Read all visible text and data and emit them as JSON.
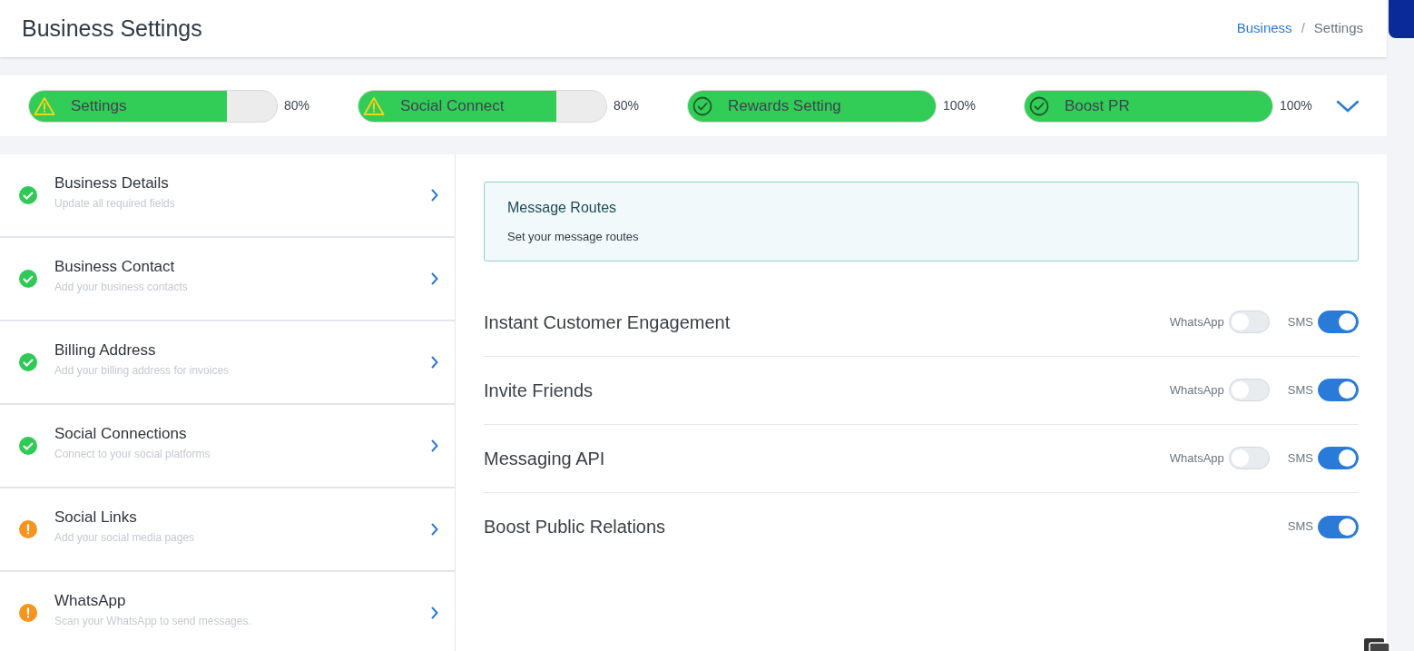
{
  "header": {
    "title": "Business Settings",
    "breadcrumb": [
      {
        "label": "Business",
        "current": false
      },
      {
        "label": "Settings",
        "current": true
      }
    ],
    "separator": "/"
  },
  "progress": [
    {
      "label": "Settings",
      "kind": "warning",
      "level": 0.8,
      "reading": "80%"
    },
    {
      "label": "Social Connect",
      "kind": "warning",
      "level": 0.8,
      "reading": "80%"
    },
    {
      "label": "Rewards Setting",
      "kind": "complete",
      "level": 1,
      "reading": "100%"
    },
    {
      "label": "Boost PR",
      "kind": "complete",
      "level": 1,
      "reading": "100%"
    }
  ],
  "sidebar": {
    "items": [
      {
        "title": "Business Details",
        "subtitle": "Update all required fields",
        "kind": "complete"
      },
      {
        "title": "Business Contact",
        "subtitle": "Add your business contacts",
        "kind": "complete"
      },
      {
        "title": "Billing Address",
        "subtitle": "Add your billing address for invoices",
        "kind": "complete"
      },
      {
        "title": "Social Connections",
        "subtitle": "Connect to your social platforms",
        "kind": "complete"
      },
      {
        "title": "Social Links",
        "subtitle": "Add your social media pages",
        "kind": "warning"
      },
      {
        "title": "WhatsApp",
        "subtitle": "Scan your WhatsApp to send messages.",
        "kind": "warning"
      }
    ]
  },
  "info": {
    "title": "Message Routes",
    "text": "Set your message routes"
  },
  "routes": [
    {
      "name": "Instant Customer Engagement",
      "channels": [
        {
          "label": "WhatsApp",
          "on": false
        },
        {
          "label": "SMS",
          "on": true
        }
      ]
    },
    {
      "name": "Invite Friends",
      "channels": [
        {
          "label": "WhatsApp",
          "on": false
        },
        {
          "label": "SMS",
          "on": true
        }
      ]
    },
    {
      "name": "Messaging API",
      "channels": [
        {
          "label": "WhatsApp",
          "on": false
        },
        {
          "label": "SMS",
          "on": true
        }
      ]
    },
    {
      "name": "Boost Public Relations",
      "channels": [
        {
          "label": "SMS",
          "on": true
        }
      ]
    }
  ]
}
